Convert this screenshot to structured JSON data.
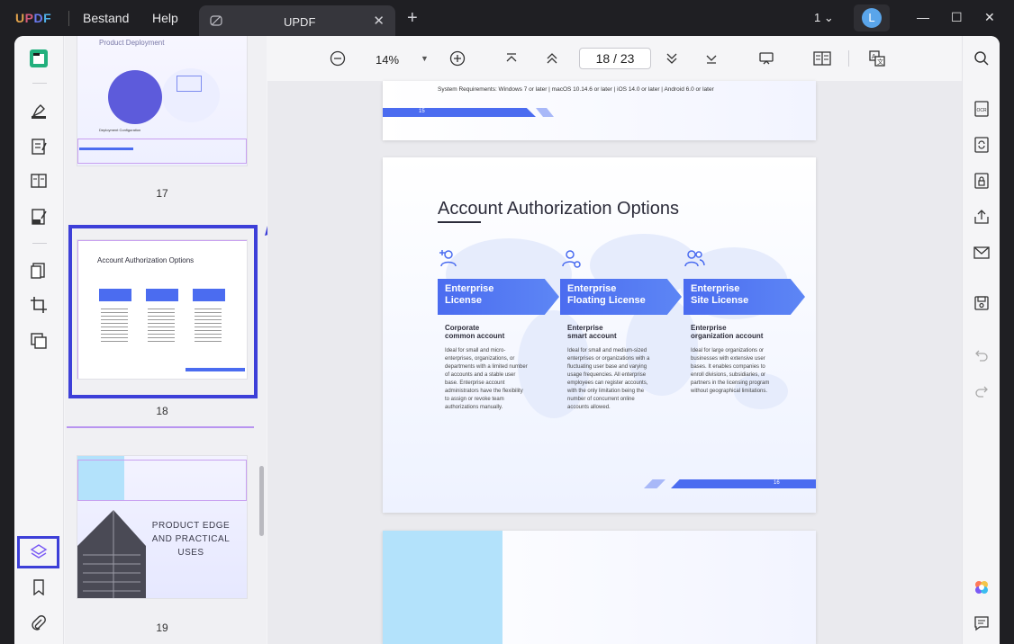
{
  "titlebar": {
    "logo": [
      "U",
      "P",
      "D",
      "F"
    ],
    "menu_bestand": "Bestand",
    "menu_help": "Help",
    "tab_title": "UPDF",
    "tab_close": "✕",
    "new_tab": "+",
    "page_count": "1",
    "avatar_letter": "L"
  },
  "toolbar": {
    "zoom_value": "14%",
    "current_page": "18",
    "page_separator": "/",
    "total_pages": "23"
  },
  "thumbnails": [
    {
      "page": "17",
      "title": "Product Deployment",
      "sub": "Deployment Configuration"
    },
    {
      "page": "18",
      "title": "Account Authorization Options"
    },
    {
      "page": "19",
      "title": "PRODUCT EDGE AND PRACTICAL USES"
    }
  ],
  "page17": {
    "sysreq": "System Requirements: Windows 7 or later | macOS 10.14.6 or later | iOS 14.0 or later | Android 6.0 or later",
    "footer_num": "15"
  },
  "page18": {
    "title": "Account Authorization Options",
    "footer_num": "16",
    "columns": [
      {
        "banner": "Enterprise\nLicense",
        "sub1": "Corporate",
        "sub2": "common account",
        "desc": "Ideal for small and micro-enterprises, organizations, or departments with a limited number of accounts and a stable user base. Enterprise account administrators have the flexibility to assign or revoke team authorizations manually."
      },
      {
        "banner": "Enterprise\nFloating License",
        "sub1": "Enterprise",
        "sub2": "smart account",
        "desc": "Ideal for small and medium-sized enterprises or organizations with a fluctuating user base and varying usage frequencies. All enterprise employees can register accounts, with the only limitation being the number of concurrent online accounts allowed."
      },
      {
        "banner": "Enterprise\nSite License",
        "sub1": "Enterprise",
        "sub2": "organization account",
        "desc": "Ideal for large organizations or businesses with extensive user bases. It enables companies to enroll divisions, subsidiaries, or partners in the licensing program without geographical limitations."
      }
    ]
  },
  "colors": {
    "accent": "#3d3fd8",
    "brand_blue": "#4b6cf0",
    "purple": "#7a5af5"
  }
}
